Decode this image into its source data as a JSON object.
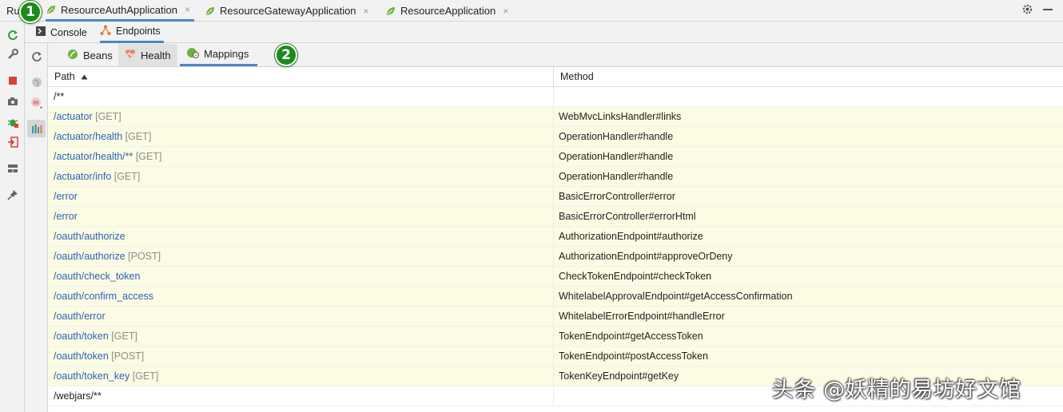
{
  "run_tabs": {
    "prefix": "Ru",
    "tabs": [
      {
        "label": "ResourceAuthApplication",
        "active": true
      },
      {
        "label": "ResourceGatewayApplication",
        "active": false
      },
      {
        "label": "ResourceApplication",
        "active": false
      }
    ],
    "close_glyph": "×"
  },
  "badges": {
    "one": "1",
    "two": "2"
  },
  "sub_tabs": {
    "console": "Console",
    "endpoints": "Endpoints"
  },
  "endpoint_tabs": {
    "beans": "Beans",
    "health": "Health",
    "mappings": "Mappings"
  },
  "table": {
    "headers": {
      "path": "Path",
      "method": "Method"
    },
    "rows": [
      {
        "path": "/**",
        "verb": "",
        "method": "",
        "highlight": false,
        "link": false
      },
      {
        "path": "/actuator",
        "verb": " [GET]",
        "method": "WebMvcLinksHandler#links",
        "highlight": true,
        "link": true
      },
      {
        "path": "/actuator/health",
        "verb": " [GET]",
        "method": "OperationHandler#handle",
        "highlight": true,
        "link": true
      },
      {
        "path": "/actuator/health/**",
        "verb": " [GET]",
        "method": "OperationHandler#handle",
        "highlight": true,
        "link": true
      },
      {
        "path": "/actuator/info",
        "verb": " [GET]",
        "method": "OperationHandler#handle",
        "highlight": true,
        "link": true
      },
      {
        "path": "/error",
        "verb": "",
        "method": "BasicErrorController#error",
        "highlight": true,
        "link": true
      },
      {
        "path": "/error",
        "verb": "",
        "method": "BasicErrorController#errorHtml",
        "highlight": true,
        "link": true
      },
      {
        "path": "/oauth/authorize",
        "verb": "",
        "method": "AuthorizationEndpoint#authorize",
        "highlight": true,
        "link": true
      },
      {
        "path": "/oauth/authorize",
        "verb": " [POST]",
        "method": "AuthorizationEndpoint#approveOrDeny",
        "highlight": true,
        "link": true
      },
      {
        "path": "/oauth/check_token",
        "verb": "",
        "method": "CheckTokenEndpoint#checkToken",
        "highlight": true,
        "link": true
      },
      {
        "path": "/oauth/confirm_access",
        "verb": "",
        "method": "WhitelabelApprovalEndpoint#getAccessConfirmation",
        "highlight": true,
        "link": true
      },
      {
        "path": "/oauth/error",
        "verb": "",
        "method": "WhitelabelErrorEndpoint#handleError",
        "highlight": true,
        "link": true
      },
      {
        "path": "/oauth/token",
        "verb": " [GET]",
        "method": "TokenEndpoint#getAccessToken",
        "highlight": true,
        "link": true
      },
      {
        "path": "/oauth/token",
        "verb": " [POST]",
        "method": "TokenEndpoint#postAccessToken",
        "highlight": true,
        "link": true
      },
      {
        "path": "/oauth/token_key",
        "verb": " [GET]",
        "method": "TokenKeyEndpoint#getKey",
        "highlight": true,
        "link": true
      },
      {
        "path": "/webjars/**",
        "verb": "",
        "method": "",
        "highlight": false,
        "link": false
      }
    ]
  },
  "watermark": "头条 @妖精的易坊好文馆",
  "colors": {
    "accent": "#4a88c7",
    "link": "#2a62b8",
    "row_highlight": "#fcfbe3",
    "badge": "#1e8a1e"
  }
}
